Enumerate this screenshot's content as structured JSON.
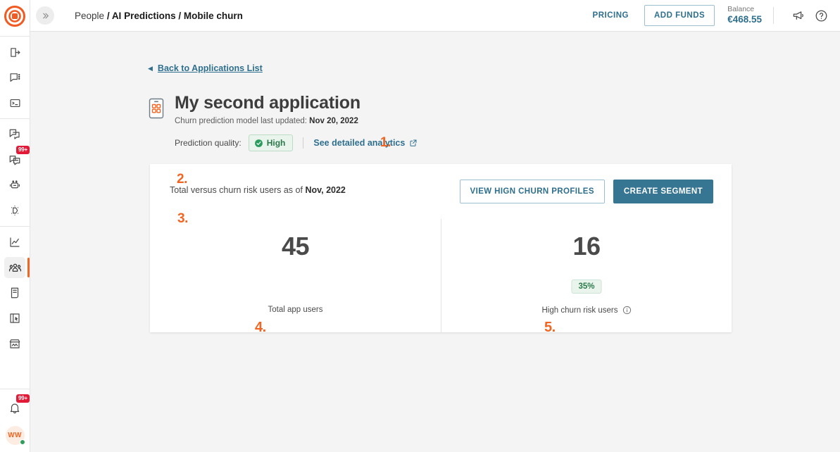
{
  "brand": {
    "logo_icon": "target-circles-logo",
    "accent_color": "#f26522",
    "link_color": "#2e6f8e"
  },
  "rail": {
    "items": [
      {
        "icon": "logout-arrow-icon",
        "name": "rail-item-logout"
      },
      {
        "icon": "chat-message-icon",
        "name": "rail-item-chat"
      },
      {
        "icon": "terminal-console-icon",
        "name": "rail-item-console"
      },
      {
        "icon": "copy-pages-icon",
        "name": "rail-item-pages"
      },
      {
        "icon": "inbox-tray-icon",
        "name": "rail-item-inbox",
        "badge": "99+"
      },
      {
        "icon": "robot-bot-icon",
        "name": "rail-item-bots"
      },
      {
        "icon": "magic-wand-sparkle-icon",
        "name": "rail-item-automation"
      },
      {
        "icon": "analytics-line-chart-icon",
        "name": "rail-item-analytics"
      },
      {
        "icon": "people-group-icon",
        "name": "rail-item-people",
        "active": true
      },
      {
        "icon": "document-page-icon",
        "name": "rail-item-articles"
      },
      {
        "icon": "board-cursor-icon",
        "name": "rail-item-board"
      },
      {
        "icon": "storefront-icon",
        "name": "rail-item-marketplace"
      }
    ],
    "notifications": {
      "icon": "bell-icon",
      "badge": "99+"
    },
    "avatar": {
      "initials": "WW",
      "status": "online"
    }
  },
  "topbar": {
    "collapse_icon": "chevron-double-right-icon",
    "breadcrumb": {
      "root": "People",
      "rest": "/ AI Predictions / Mobile churn"
    },
    "pricing_label": "PRICING",
    "add_funds_label": "ADD FUNDS",
    "balance_label": "Balance",
    "balance_value": "€468.55",
    "megaphone_icon": "megaphone-icon",
    "help_icon": "help-circle-icon"
  },
  "page": {
    "back_link": "Back to Applications List",
    "back_caret_icon": "caret-left-icon",
    "app_icon": "mobile-app-icon",
    "title": "My second application",
    "subtitle_prefix": "Churn prediction model last updated: ",
    "subtitle_date": "Nov 20, 2022",
    "quality_label": "Prediction quality:",
    "quality_value": "High",
    "quality_icon": "check-circle-icon",
    "analytics_link": "See detailed analytics",
    "analytics_icon": "external-link-icon"
  },
  "card": {
    "title_prefix": "Total versus churn risk users as of ",
    "title_date": "Nov, 2022",
    "view_profiles_label": "VIEW HIGN CHURN PROFILES",
    "create_segment_label": "CREATE SEGMENT",
    "stats": [
      {
        "value": "45",
        "label": "Total app users"
      },
      {
        "value": "16",
        "percent": "35%",
        "label": "High churn risk users",
        "info_icon": "info-circle-icon"
      }
    ]
  },
  "annotations": {
    "one": "1.",
    "two": "2.",
    "three": "3.",
    "four": "4.",
    "five": "5."
  }
}
